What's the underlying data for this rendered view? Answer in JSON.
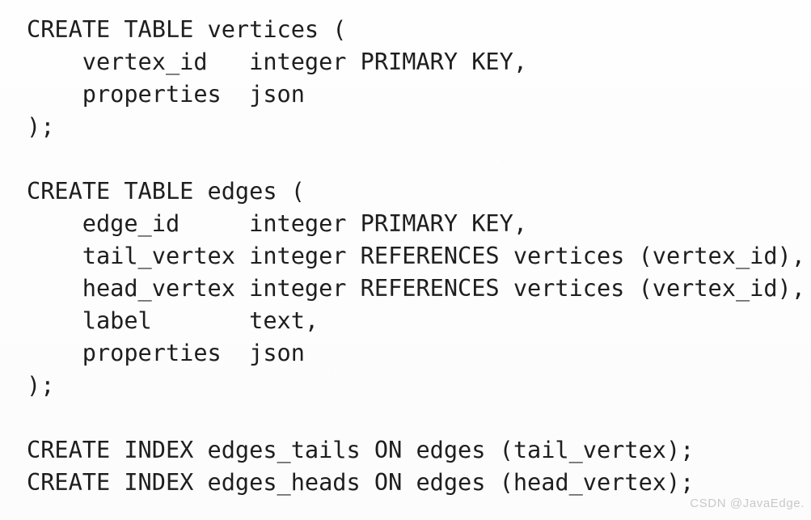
{
  "code": {
    "language": "sql",
    "lines": [
      "CREATE TABLE vertices (",
      "    vertex_id   integer PRIMARY KEY,",
      "    properties  json",
      ");",
      "",
      "CREATE TABLE edges (",
      "    edge_id     integer PRIMARY KEY,",
      "    tail_vertex integer REFERENCES vertices (vertex_id),",
      "    head_vertex integer REFERENCES vertices (vertex_id),",
      "    label       text,",
      "    properties  json",
      ");",
      "",
      "CREATE INDEX edges_tails ON edges (tail_vertex);",
      "CREATE INDEX edges_heads ON edges (head_vertex);"
    ]
  },
  "watermark": {
    "text": "CSDN @JavaEdge."
  },
  "colors": {
    "background": "#fdfdfd",
    "text": "#1e1e1e",
    "watermark": "#c9c9c9"
  }
}
